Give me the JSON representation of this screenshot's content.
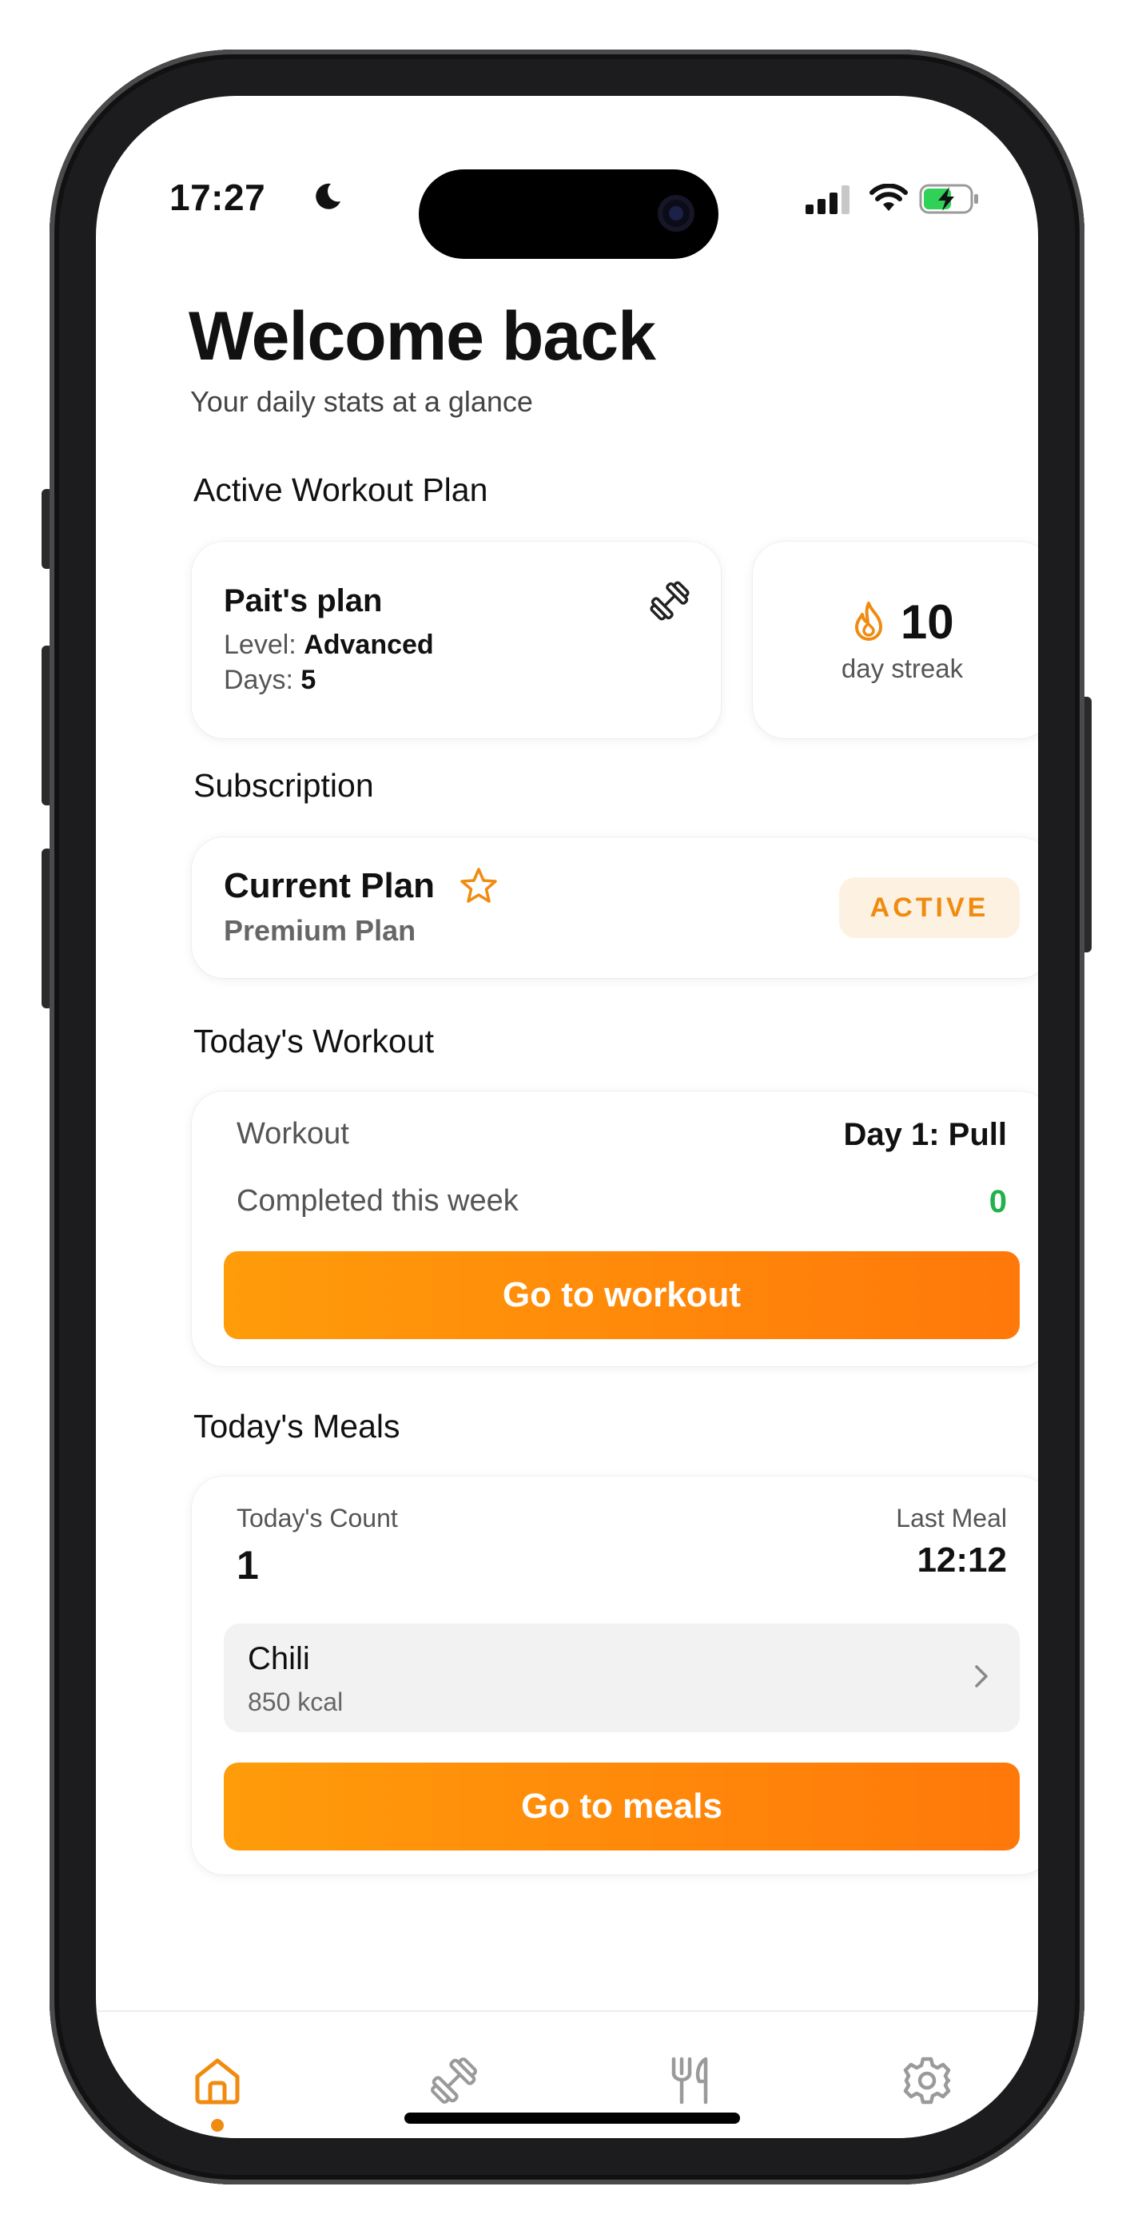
{
  "status_bar": {
    "time": "17:27"
  },
  "header": {
    "title": "Welcome back",
    "subtitle": "Your daily stats at a glance"
  },
  "active_plan": {
    "section_title": "Active Workout Plan",
    "plan_name": "Pait's plan",
    "level_label": "Level:",
    "level_value": "Advanced",
    "days_label": "Days:",
    "days_value": "5",
    "icon": "dumbbell-icon"
  },
  "streak": {
    "value": "10",
    "label": "day streak",
    "icon": "flame-icon"
  },
  "subscription": {
    "section_title": "Subscription",
    "title": "Current Plan",
    "plan_name": "Premium Plan",
    "badge": "ACTIVE",
    "icon": "star-icon"
  },
  "workout": {
    "section_title": "Today's Workout",
    "row1_label": "Workout",
    "row1_value": "Day 1: Pull",
    "row2_label": "Completed this week",
    "row2_value": "0",
    "button_label": "Go to workout"
  },
  "meals": {
    "section_title": "Today's Meals",
    "count_label": "Today's Count",
    "count_value": "1",
    "last_meal_label": "Last Meal",
    "last_meal_value": "12:12",
    "item_name": "Chili",
    "item_kcal": "850 kcal",
    "button_label": "Go to meals"
  },
  "tabbar": {
    "active": "home",
    "tabs": [
      {
        "id": "home",
        "icon": "home-icon"
      },
      {
        "id": "workouts",
        "icon": "dumbbell-icon"
      },
      {
        "id": "meals",
        "icon": "fork-knife-icon"
      },
      {
        "id": "settings",
        "icon": "gear-icon"
      }
    ]
  },
  "colors": {
    "accent": "#f08b10",
    "accent_gradient_start": "#ff9c0a",
    "accent_gradient_end": "#ff780a",
    "success": "#22b14c",
    "badge_bg": "#fdf1e2",
    "inactive_icon": "#9a9a9a"
  }
}
